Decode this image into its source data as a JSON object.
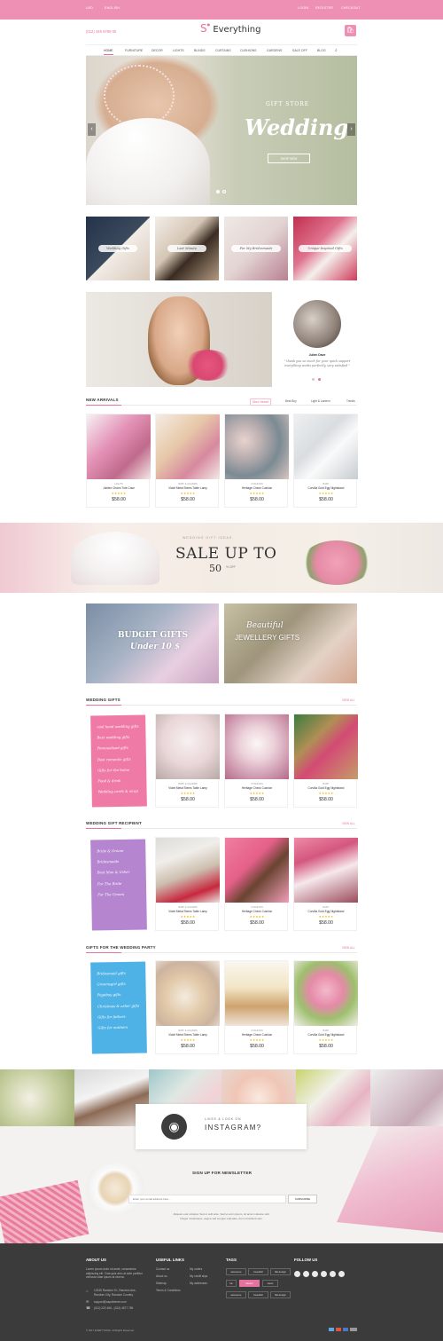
{
  "topbar": {
    "left1": "USD",
    "left2": "ENGLISH",
    "r1": "LOGIN",
    "r2": "REGISTER",
    "r3": "CHECKOUT"
  },
  "header": {
    "phone": "(012) 345 6789 00",
    "logo": "Everything",
    "cart_icon": "cart-icon"
  },
  "nav": {
    "items": [
      "HOME",
      "FURNITURE",
      "DECOR",
      "LIGHTS",
      "BLINDS",
      "CURTAINS",
      "CUSHIONS",
      "GARDENS",
      "SALE OFF",
      "BLOG"
    ]
  },
  "hero": {
    "subtitle": "GIFT STORE",
    "title": "Wedding",
    "button": "SHOP NOW"
  },
  "categories": [
    "Wedding Gifts",
    "Last Minute",
    "For My Bridesmaids",
    "Unique Inspired Gifts"
  ],
  "testimonial": {
    "name": "Julien Dave",
    "quote": "\" thank you so much for your quick support everything works perfectly, very satisfied \""
  },
  "new_arrivals": {
    "title": "NEW ARRIVALS",
    "tabs": [
      "Most Viewed",
      "Best Buy",
      "Light & Lantern",
      "Trends"
    ],
    "products": [
      {
        "category": "LIGHTS",
        "name": "Jubilee Charm Tote Case",
        "stars": "★★★★★",
        "price": "$58.00"
      },
      {
        "category": "BABY & CHARMS",
        "name": "Violet Metal Stems Table Lamp",
        "stars": "★★★★★",
        "price": "$58.00"
      },
      {
        "category": "CUSHIONS",
        "name": "Heritage Check Cushion",
        "stars": "★★★★★",
        "price": "$58.00"
      },
      {
        "category": "BABY",
        "name": "Corvilla Gold Egg Nightstand",
        "stars": "★★★★★",
        "price": "$58.00"
      }
    ]
  },
  "sale_banner": {
    "kicker": "WEDDING GIFT IDEAS",
    "main": "SALE UP TO",
    "pct": "50",
    "off": "% OFF"
  },
  "gift_banners": {
    "budget_line1": "BUDGET GIFTS",
    "budget_line2": "Under 10 $",
    "jewel_line1": "Beautiful",
    "jewel_line2": "JEWELLERY GIFTS"
  },
  "wedding_gifts": {
    "title": "WEDDING GIFTS",
    "view_all": "VIEW ALL",
    "links": [
      "cool hand wedding gifts",
      "Best wedding gifts",
      "Personalised gifts",
      "Best romantic gifts",
      "Gifts for the home",
      "Food & drink",
      "Wedding cards & wrap"
    ],
    "products": [
      {
        "category": "BABY & CHARMS",
        "name": "Violet Metal Stems Table Lamp",
        "stars": "★★★★★",
        "price": "$58.00"
      },
      {
        "category": "CUSHIONS",
        "name": "Heritage Check Cushion",
        "stars": "★★★★★",
        "price": "$58.00"
      },
      {
        "category": "BABY",
        "name": "Corvilla Gold Egg Nightstand",
        "stars": "★★★★★",
        "price": "$58.00"
      }
    ]
  },
  "recipient": {
    "title": "WEDDING GIFT RECIPIENT",
    "view_all": "VIEW ALL",
    "links": [
      "Bride & Groom",
      "Bridesmaids",
      "Best Man & Usher",
      "For The Bride",
      "For The Groom"
    ],
    "products": [
      {
        "category": "BABY & CHARMS",
        "name": "Violet Metal Stems Table Lamp",
        "stars": "★★★★★",
        "price": "$58.00"
      },
      {
        "category": "CUSHIONS",
        "name": "Heritage Check Cushion",
        "stars": "★★★★★",
        "price": "$58.00"
      },
      {
        "category": "BABY",
        "name": "Corvilla Gold Egg Nightstand",
        "stars": "★★★★★",
        "price": "$58.00"
      }
    ]
  },
  "party": {
    "title": "GIFTS FOR THE WEDDING PARTY",
    "view_all": "VIEW ALL",
    "links": [
      "Bridesmaid gifts",
      "Groomsgirl gifts",
      "Pageboy gifts",
      "Christmas & usher gifts",
      "Gifts for fathers",
      "Gifts for mothers"
    ],
    "products": [
      {
        "category": "BABY & CHARMS",
        "name": "Violet Metal Stems Table Lamp",
        "stars": "★★★★★",
        "price": "$58.00"
      },
      {
        "category": "CUSHIONS",
        "name": "Heritage Check Cushion",
        "stars": "★★★★★",
        "price": "$58.00"
      },
      {
        "category": "BABY",
        "name": "Corvilla Gold Egg Nightstand",
        "stars": "★★★★★",
        "price": "$58.00"
      }
    ]
  },
  "instagram": {
    "kicker": "LIKES & LOOK ON",
    "title": "INSTAGRAM?"
  },
  "newsletter": {
    "title": "SIGN UP FOR NEWSLETTER",
    "placeholder": "Enter your email address here...",
    "button": "SUBSCRIBE",
    "note1": "Aliquam erat volutpat. Sed ut velit ante. Sed ut enim ipsum, sit amet molestie velit.",
    "note2": "Integer scelerisque, augue sed congue vulputate, dui mi tincidunt sem."
  },
  "footer": {
    "about_title": "ABOUT US",
    "about_text": "Lorem ipsum dolor sit amet, consectetur adipiscing elit. Cras quis arcu at ante porttitor vehicula vitae ipsum at viverra.",
    "address": "12345 Random St., Random Ave., Random City, Random Country",
    "email": "support@capotheme.com",
    "phone": "(012) 222 456 - (012) 4577 789",
    "links_title": "USEFUL LINKS",
    "links": [
      "Contact us",
      "About us",
      "Sitemap",
      "Terms & Conditions",
      "My orders",
      "My credit slips",
      "My addresses"
    ],
    "tags_title": "TAGS",
    "tags": [
      "awesome",
      "beautiful",
      "flat design",
      "fun",
      "interior",
      "clean",
      "awesome",
      "beautiful",
      "flat design"
    ],
    "follow_title": "FOLLOW US",
    "copyright": "© 2017 EVERYTHING. All Rights Reserved"
  }
}
